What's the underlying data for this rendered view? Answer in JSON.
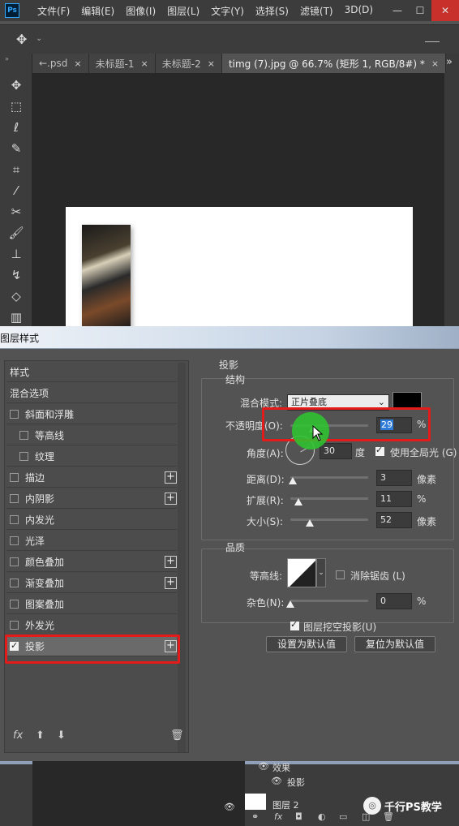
{
  "app": {
    "logo": "Ps"
  },
  "menu": [
    "文件(F)",
    "编辑(E)",
    "图像(I)",
    "图层(L)",
    "文字(Y)",
    "选择(S)",
    "滤镜(T)",
    "3D(D)"
  ],
  "window_buttons": {
    "minimize": "—",
    "maximize": "☐",
    "close": "✕"
  },
  "tabs": [
    {
      "label": "←.psd",
      "close": "×"
    },
    {
      "label": "未标题-1",
      "close": "×"
    },
    {
      "label": "未标题-2",
      "close": "×"
    },
    {
      "label": "timg (7).jpg @ 66.7% (矩形 1, RGB/8#) *",
      "close": "×"
    }
  ],
  "tabs_overflow": "»",
  "dialog": {
    "title": "图层样式",
    "list": [
      {
        "label": "样式"
      },
      {
        "label": "混合选项"
      },
      {
        "label": "斜面和浮雕",
        "checked": false
      },
      {
        "label": "等高线",
        "checked": false
      },
      {
        "label": "纹理",
        "checked": false
      },
      {
        "label": "描边",
        "checked": false,
        "plus": "+"
      },
      {
        "label": "内阴影",
        "checked": false,
        "plus": "+"
      },
      {
        "label": "内发光",
        "checked": false
      },
      {
        "label": "光泽",
        "checked": false
      },
      {
        "label": "颜色叠加",
        "checked": false,
        "plus": "+"
      },
      {
        "label": "渐变叠加",
        "checked": false,
        "plus": "+"
      },
      {
        "label": "图案叠加",
        "checked": false
      },
      {
        "label": "外发光",
        "checked": false
      },
      {
        "label": "投影",
        "checked": true,
        "plus": "+"
      }
    ],
    "fx_label": "fx",
    "panel": {
      "heading": "投影",
      "structure": {
        "title": "结构",
        "blend_mode_label": "混合模式:",
        "blend_mode_value": "正片叠底",
        "color": "#000000",
        "opacity_label": "不透明度(O):",
        "opacity_value": "29",
        "opacity_unit": "%",
        "opacity_level": 0.29,
        "angle_label": "角度(A):",
        "angle_value": "30",
        "angle_unit": "度",
        "global_light_label": "使用全局光 (G)",
        "global_light_checked": true,
        "distance_label": "距离(D):",
        "distance_value": "3",
        "distance_unit": "像素",
        "spread_label": "扩展(R):",
        "spread_value": "11",
        "spread_unit": "%",
        "size_label": "大小(S):",
        "size_value": "52",
        "size_unit": "像素"
      },
      "quality": {
        "title": "品质",
        "contour_label": "等高线:",
        "antialias_label": "消除锯齿 (L)",
        "antialias_checked": false,
        "noise_label": "杂色(N):",
        "noise_value": "0",
        "noise_unit": "%"
      },
      "knockout_label": "图层挖空投影(U)",
      "knockout_checked": true,
      "set_default": "设置为默认值",
      "reset_default": "复位为默认值"
    }
  },
  "layers": {
    "effects_label": "效果",
    "drop_shadow_label": "投影",
    "layer_name": "图层 2"
  },
  "watermark": {
    "text": "千行PS教学"
  },
  "accent_colors": {
    "highlight_red": "#e31b1b",
    "cursor_green": "#2fc42f",
    "ps_blue": "#31a8ff"
  }
}
